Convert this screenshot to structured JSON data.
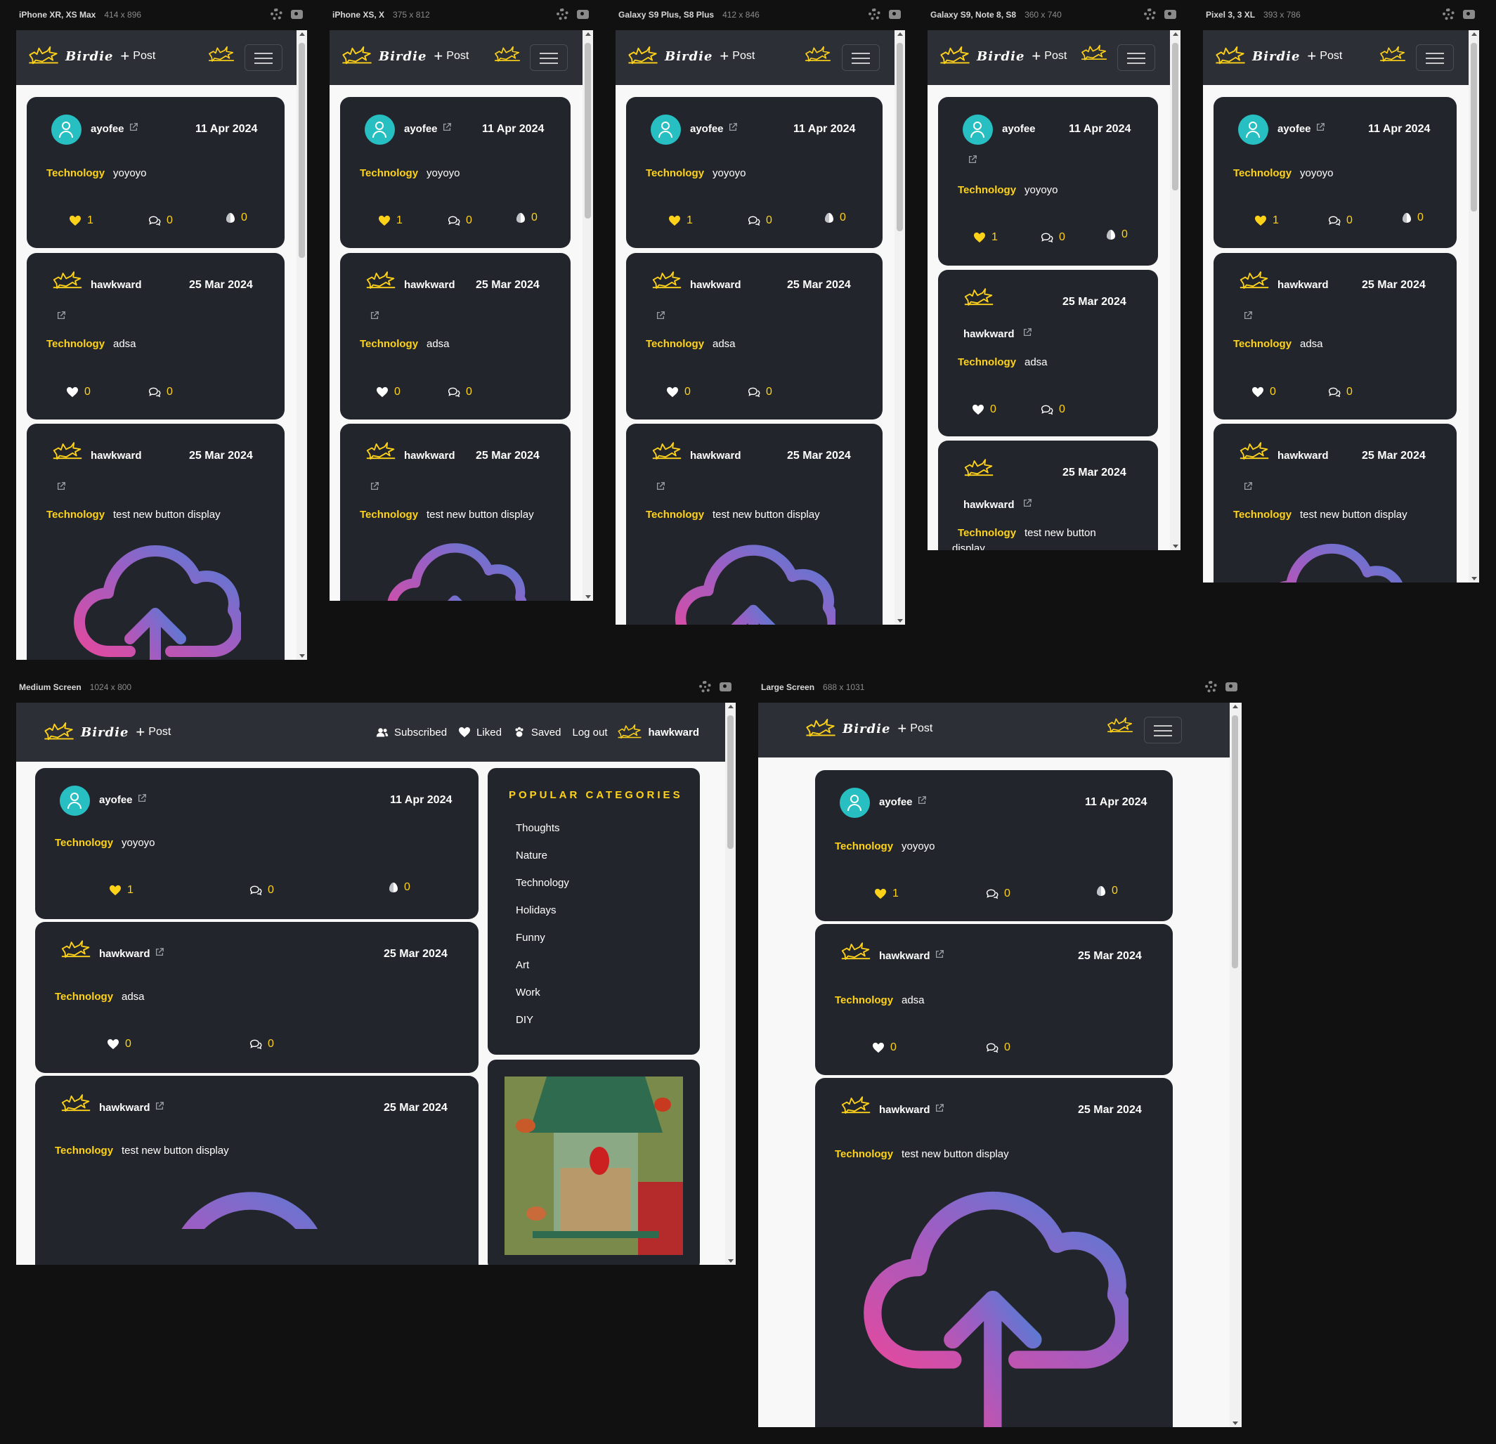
{
  "brand": {
    "name": "Birdie",
    "plus": "+",
    "post": "Post"
  },
  "screens": [
    {
      "device": "iPhone XR, XS Max",
      "size": "414 x 896"
    },
    {
      "device": "iPhone XS, X",
      "size": "375 x 812"
    },
    {
      "device": "Galaxy S9 Plus, S8 Plus",
      "size": "412 x 846"
    },
    {
      "device": "Galaxy S9, Note 8, S8",
      "size": "360 x 740"
    },
    {
      "device": "Pixel 3, 3 XL",
      "size": "393 x 786"
    },
    {
      "device": "Medium Screen",
      "size": "1024 x 800"
    },
    {
      "device": "Large Screen",
      "size": "688 x 1031"
    }
  ],
  "posts": [
    {
      "user": "ayofee",
      "date": "11 Apr 2024",
      "category": "Technology",
      "text": "yoyoyo",
      "likes": "1",
      "comments": "0",
      "saves": "0",
      "liked": true
    },
    {
      "user": "hawkward",
      "date": "25 Mar 2024",
      "category": "Technology",
      "text": "adsa",
      "likes": "0",
      "comments": "0"
    },
    {
      "user": "hawkward",
      "date": "25 Mar 2024",
      "category": "Technology",
      "text": "test new button display"
    }
  ],
  "post3_text_wrapped": {
    "line1": "test new button",
    "line2": "display"
  },
  "nav_links": {
    "subscribed": "Subscribed",
    "liked": "Liked",
    "saved": "Saved",
    "logout": "Log out",
    "user": "hawkward"
  },
  "popular": {
    "title": "Popular Categories",
    "items": [
      "Thoughts",
      "Nature",
      "Technology",
      "Holidays",
      "Funny",
      "Art",
      "Work",
      "DIY"
    ]
  },
  "colors": {
    "accent": "#ffd21a",
    "card": "#22262c",
    "nav": "#2c2f35",
    "avatar": "#27bfc2"
  },
  "icons": {
    "like": "heart-icon",
    "comment": "comment-icon",
    "save": "egg-icon",
    "logo": "bird-logo-icon",
    "external": "external-link-icon"
  }
}
